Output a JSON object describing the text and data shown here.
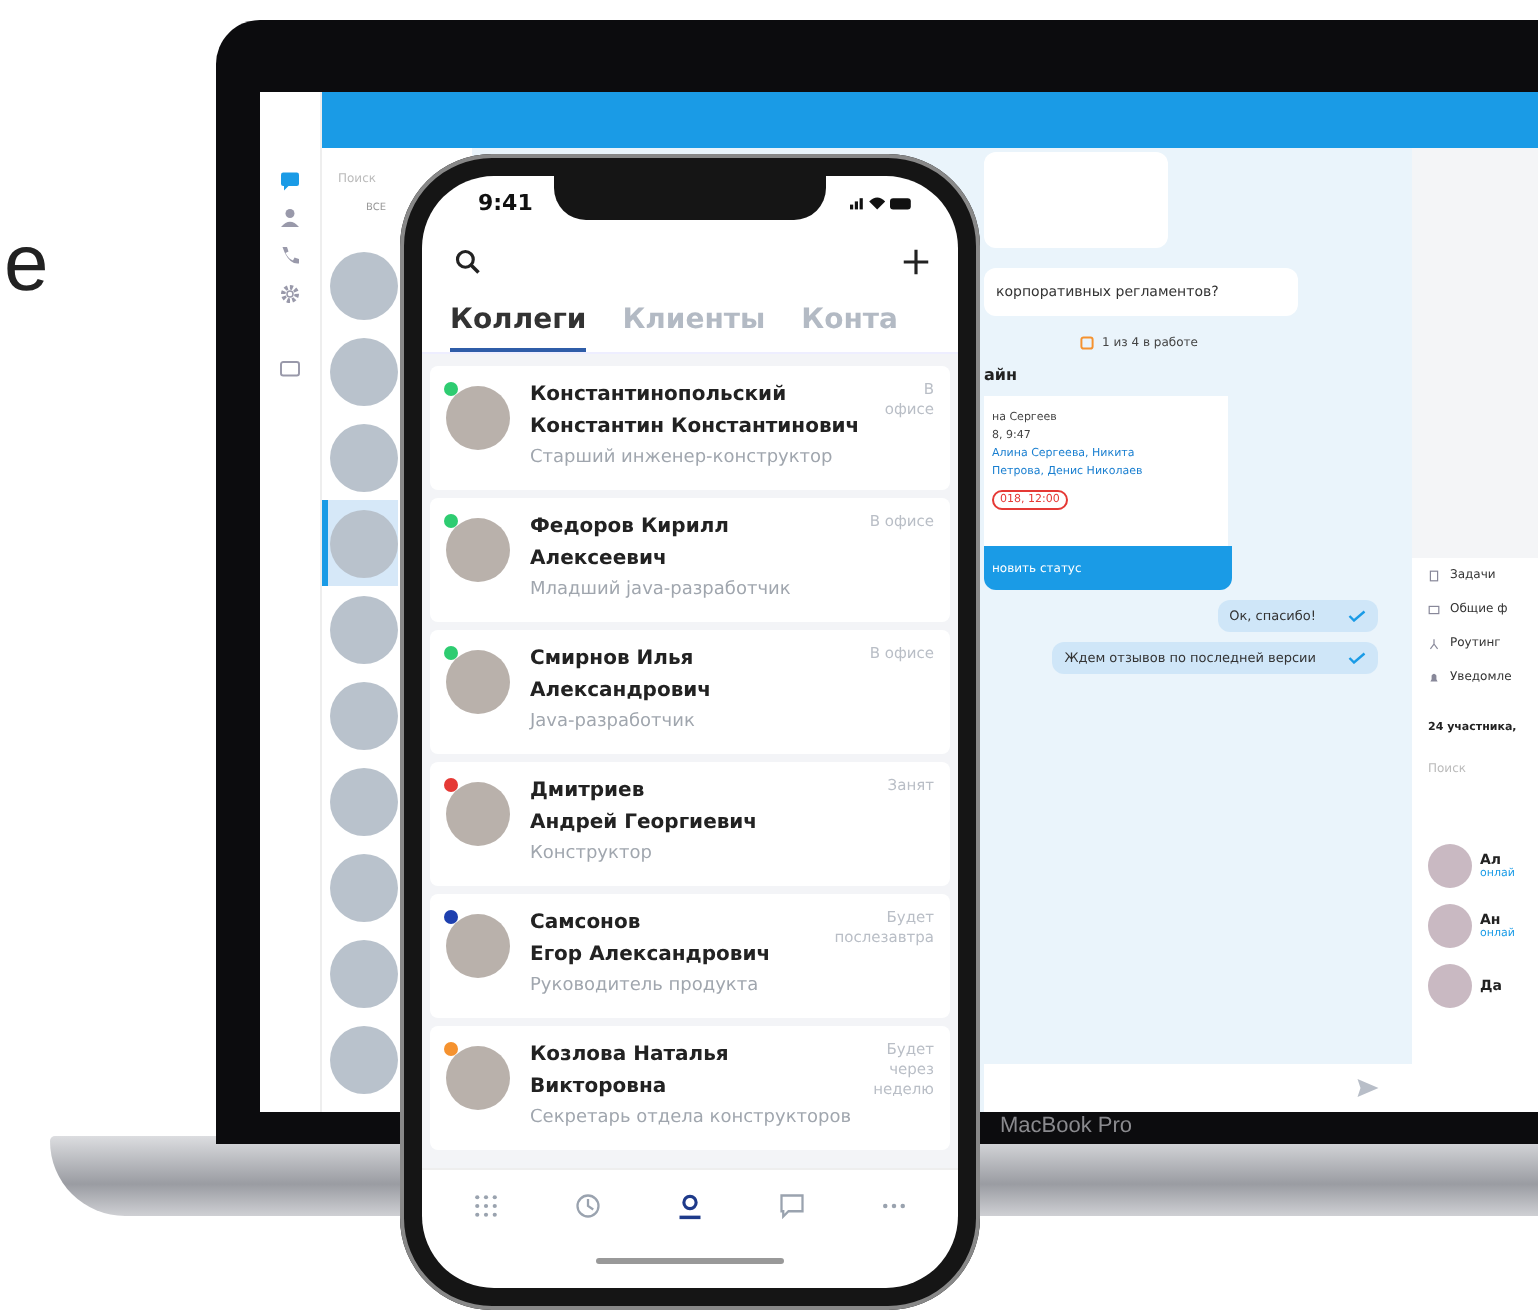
{
  "side_text": "e",
  "laptop": {
    "brand": "MacBook Pro",
    "nav_icons": [
      {
        "kind": "chat",
        "selected": true
      },
      {
        "kind": "person",
        "selected": false
      },
      {
        "kind": "phone",
        "selected": false
      },
      {
        "kind": "gear",
        "selected": false
      },
      {
        "kind": "folder",
        "selected": false
      }
    ],
    "contact_list": {
      "search_placeholder": "Поиск",
      "filter": "ВСЕ",
      "avatars": [
        {
          "selected": false
        },
        {
          "selected": false
        },
        {
          "selected": false
        },
        {
          "selected": true
        },
        {
          "selected": false
        },
        {
          "selected": false
        },
        {
          "selected": false
        },
        {
          "selected": false
        },
        {
          "selected": false
        },
        {
          "selected": false
        }
      ]
    },
    "chat": {
      "incoming": "корпоративных регламентов?",
      "task_status": "1 из 4 в работе",
      "card_title": "айн",
      "card_lines": [
        {
          "kind": "plain",
          "text": "на Сергеев"
        },
        {
          "kind": "plain",
          "text": "8, 9:47"
        },
        {
          "kind": "link",
          "text": "Алина Сергеева, Никита"
        },
        {
          "kind": "link",
          "text": "Петрова, Денис Николаев"
        },
        {
          "kind": "deadline",
          "text": "018, 12:00"
        }
      ],
      "card_button": "новить статус",
      "outgoing": [
        "Ок, спасибо!",
        "Ждем отзывов по последней версии"
      ]
    },
    "right_panel": {
      "menu": [
        {
          "kind": "tasks",
          "label": "Задачи"
        },
        {
          "kind": "files",
          "label": "Общие ф"
        },
        {
          "kind": "routing",
          "label": "Роутинг"
        },
        {
          "kind": "bell",
          "label": "Уведомле"
        }
      ],
      "members_title": "24 участника,",
      "search_placeholder": "Поиск",
      "members": [
        {
          "name": "Ал",
          "status": "онлай"
        },
        {
          "name": "Ан",
          "status": "онлай"
        },
        {
          "name": "Да"
        }
      ]
    }
  },
  "phone": {
    "time": "9:41",
    "tabs": [
      {
        "label": "Коллеги",
        "selected": true
      },
      {
        "label": "Клиенты",
        "selected": false
      },
      {
        "label": "Конта",
        "selected": false
      }
    ],
    "contacts": [
      {
        "name_lines": [
          "Константинопольский",
          "Константин Константинович"
        ],
        "role": "Старший инженер-конструктор",
        "status": "В офисе",
        "color": "#2ecc71"
      },
      {
        "name_lines": [
          "Федоров Кирилл",
          "Алексеевич"
        ],
        "role": "Младший java-разработчик",
        "status": "В офисе",
        "color": "#2ecc71"
      },
      {
        "name_lines": [
          "Смирнов Илья",
          "Александрович"
        ],
        "role": "Java-разработчик",
        "status": "В офисе",
        "color": "#2ecc71"
      },
      {
        "name_lines": [
          "Дмитриев",
          "Андрей Георгиевич"
        ],
        "role": "Конструктор",
        "status": "Занят",
        "color": "#e53935"
      },
      {
        "name_lines": [
          "Самсонов",
          "Егор Александрович"
        ],
        "role": "Руководитель продукта",
        "status": "Будет послезавтра",
        "color": "#1e40af"
      },
      {
        "name_lines": [
          "Козлова Наталья",
          "Викторовна"
        ],
        "role": "Секретарь отдела конструкторов",
        "status": "Будет через неделю",
        "color": "#f5922f"
      }
    ],
    "bottom_nav": [
      {
        "kind": "grid",
        "selected": false
      },
      {
        "kind": "clock",
        "selected": false
      },
      {
        "kind": "person",
        "selected": true
      },
      {
        "kind": "chat",
        "selected": false
      },
      {
        "kind": "more",
        "selected": false
      }
    ]
  }
}
